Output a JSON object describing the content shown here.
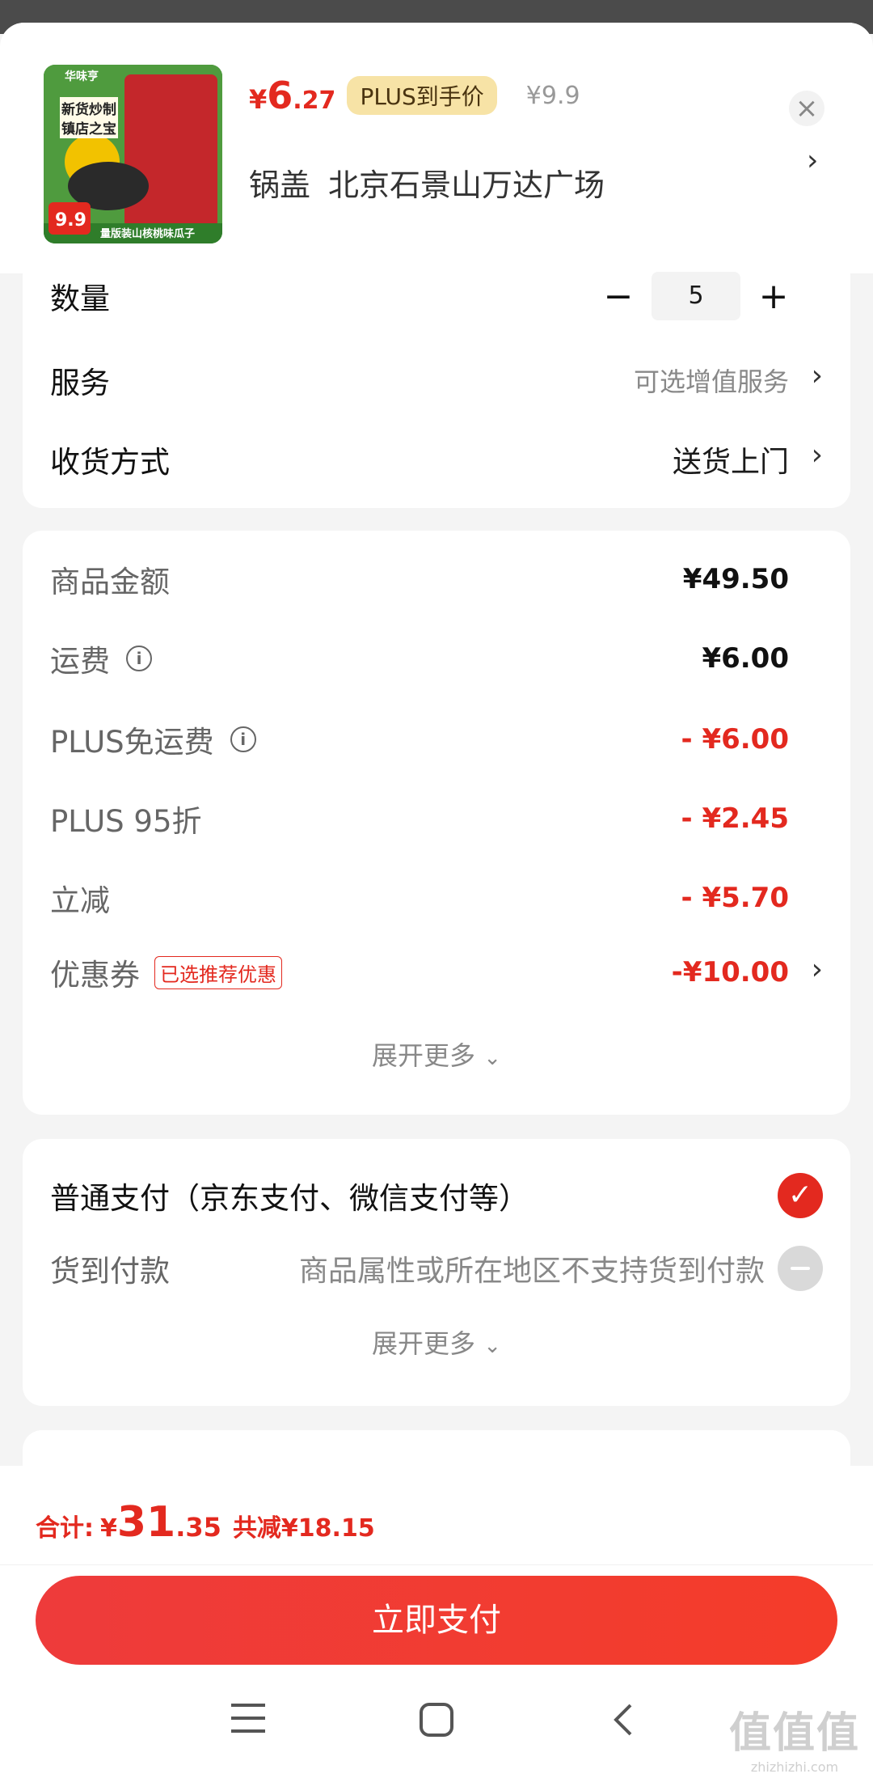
{
  "product": {
    "thumb_brand": "华味亨",
    "thumb_line1": "新货炒制",
    "thumb_line2": "镇店之宝",
    "thumb_badge_price": "9.9",
    "thumb_banner": "量版装山核桃味瓜子",
    "price_symbol": "¥",
    "price_int": "6",
    "price_dec": ".27",
    "plus_tag": "PLUS到手价",
    "original_price": "¥9.9",
    "store_prefix": "锅盖",
    "store_name": "北京石景山万达广场"
  },
  "options": {
    "quantity_label": "数量",
    "quantity_value": "5",
    "service_label": "服务",
    "service_value": "可选增值服务",
    "delivery_label": "收货方式",
    "delivery_value": "送货上门"
  },
  "summary": {
    "goods_label": "商品金额",
    "goods_value": "¥49.50",
    "shipping_label": "运费",
    "shipping_value": "¥6.00",
    "plus_free_label": "PLUS免运费",
    "plus_free_value": "- ¥6.00",
    "plus_discount_label": "PLUS 95折",
    "plus_discount_value": "- ¥2.45",
    "instant_label": "立减",
    "instant_value": "- ¥5.70",
    "coupon_label": "优惠券",
    "coupon_tag": "已选推荐优惠",
    "coupon_value": "-¥10.00",
    "expand_more": "展开更多"
  },
  "payment": {
    "normal_label": "普通支付（京东支付、微信支付等）",
    "cod_label": "货到付款",
    "cod_note": "商品属性或所在地区不支持货到付款",
    "expand_more": "展开更多"
  },
  "footer": {
    "total_label": "合计:",
    "total_symbol": "¥",
    "total_int": "31",
    "total_dec": ".35",
    "saved": "共减¥18.15",
    "pay_button": "立即支付"
  },
  "watermark": {
    "text": "值值值",
    "url": "zhizhizhi.com"
  },
  "colors": {
    "accent": "#e3291f",
    "plus_tag_bg": "#f7e3a6"
  }
}
